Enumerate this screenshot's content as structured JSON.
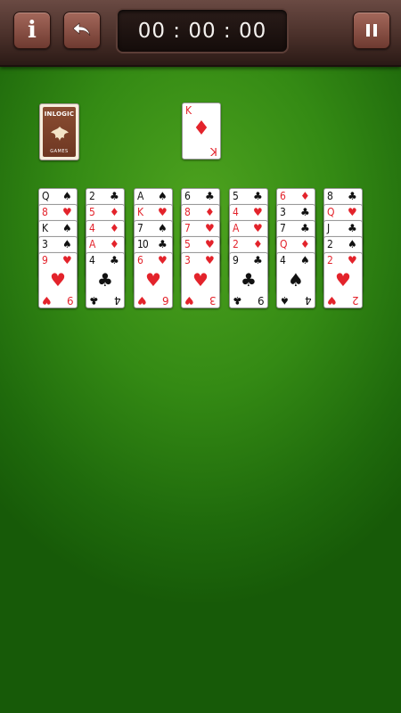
{
  "topbar": {
    "info_label": "i",
    "timer": "00 : 00 : 00"
  },
  "stock": {
    "brand": "INLOGIC",
    "sub": "GAMES"
  },
  "waste": {
    "rank": "K",
    "suit": "♦",
    "color": "red"
  },
  "columns": [
    [
      {
        "rank": "Q",
        "suit": "♠",
        "color": "black"
      },
      {
        "rank": "8",
        "suit": "♥",
        "color": "red"
      },
      {
        "rank": "K",
        "suit": "♠",
        "color": "black"
      },
      {
        "rank": "3",
        "suit": "♠",
        "color": "black"
      },
      {
        "rank": "9",
        "suit": "♥",
        "color": "red"
      }
    ],
    [
      {
        "rank": "2",
        "suit": "♣",
        "color": "black"
      },
      {
        "rank": "5",
        "suit": "♦",
        "color": "red"
      },
      {
        "rank": "4",
        "suit": "♦",
        "color": "red"
      },
      {
        "rank": "A",
        "suit": "♦",
        "color": "red"
      },
      {
        "rank": "4",
        "suit": "♣",
        "color": "black"
      }
    ],
    [
      {
        "rank": "A",
        "suit": "♠",
        "color": "black"
      },
      {
        "rank": "K",
        "suit": "♥",
        "color": "red"
      },
      {
        "rank": "7",
        "suit": "♠",
        "color": "black"
      },
      {
        "rank": "10",
        "suit": "♣",
        "color": "black"
      },
      {
        "rank": "6",
        "suit": "♥",
        "color": "red"
      }
    ],
    [
      {
        "rank": "6",
        "suit": "♣",
        "color": "black"
      },
      {
        "rank": "8",
        "suit": "♦",
        "color": "red"
      },
      {
        "rank": "7",
        "suit": "♥",
        "color": "red"
      },
      {
        "rank": "5",
        "suit": "♥",
        "color": "red"
      },
      {
        "rank": "3",
        "suit": "♥",
        "color": "red"
      }
    ],
    [
      {
        "rank": "5",
        "suit": "♣",
        "color": "black"
      },
      {
        "rank": "4",
        "suit": "♥",
        "color": "red"
      },
      {
        "rank": "A",
        "suit": "♥",
        "color": "red"
      },
      {
        "rank": "2",
        "suit": "♦",
        "color": "red"
      },
      {
        "rank": "9",
        "suit": "♣",
        "color": "black"
      }
    ],
    [
      {
        "rank": "6",
        "suit": "♦",
        "color": "red"
      },
      {
        "rank": "3",
        "suit": "♣",
        "color": "black"
      },
      {
        "rank": "7",
        "suit": "♣",
        "color": "black"
      },
      {
        "rank": "Q",
        "suit": "♦",
        "color": "red"
      },
      {
        "rank": "4",
        "suit": "♠",
        "color": "black"
      }
    ],
    [
      {
        "rank": "8",
        "suit": "♣",
        "color": "black"
      },
      {
        "rank": "Q",
        "suit": "♥",
        "color": "red"
      },
      {
        "rank": "J",
        "suit": "♣",
        "color": "black"
      },
      {
        "rank": "2",
        "suit": "♠",
        "color": "black"
      },
      {
        "rank": "2",
        "suit": "♥",
        "color": "red"
      }
    ]
  ]
}
